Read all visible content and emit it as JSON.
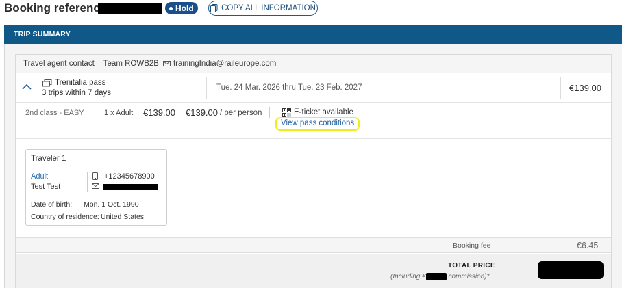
{
  "header": {
    "booking_reference_label": "Booking reference:",
    "status_badge": "Hold",
    "copy_button_label": "COPY ALL INFORMATION"
  },
  "trip_summary": {
    "title": "TRIP SUMMARY",
    "agent": {
      "label": "Travel agent contact",
      "team": "Team ROWB2B",
      "email": "trainingIndia@raileurope.com"
    },
    "pass": {
      "name": "Trenitalia pass",
      "subtitle": "3 trips within 7 days",
      "dates": "Tue. 24 Mar. 2026 thru Tue. 23 Feb. 2027",
      "price": "€139.00"
    },
    "detail": {
      "class": "2nd class - EASY",
      "quantity": "1 x Adult",
      "unit_price": "€139.00",
      "total_price": "€139.00",
      "per_person": "/ per person",
      "eticket": "E-ticket available",
      "view_conditions": "View pass conditions"
    },
    "traveler": {
      "title": "Traveler 1",
      "type": "Adult",
      "name": "Test Test",
      "phone": "+12345678900",
      "dob_label": "Date of birth:",
      "dob": "Mon. 1 Oct. 1990",
      "country_label": "Country of residence:",
      "country": "United States"
    },
    "booking_fee_label": "Booking fee",
    "booking_fee": "€6.45",
    "total_label": "TOTAL PRICE",
    "total_note_prefix": "(Including €",
    "total_note_suffix": "commission)*"
  },
  "colors": {
    "header_bar": "#0f5888",
    "badge": "#1a4f8b",
    "link": "#1f5fa0",
    "highlight": "#f2ec1c"
  }
}
